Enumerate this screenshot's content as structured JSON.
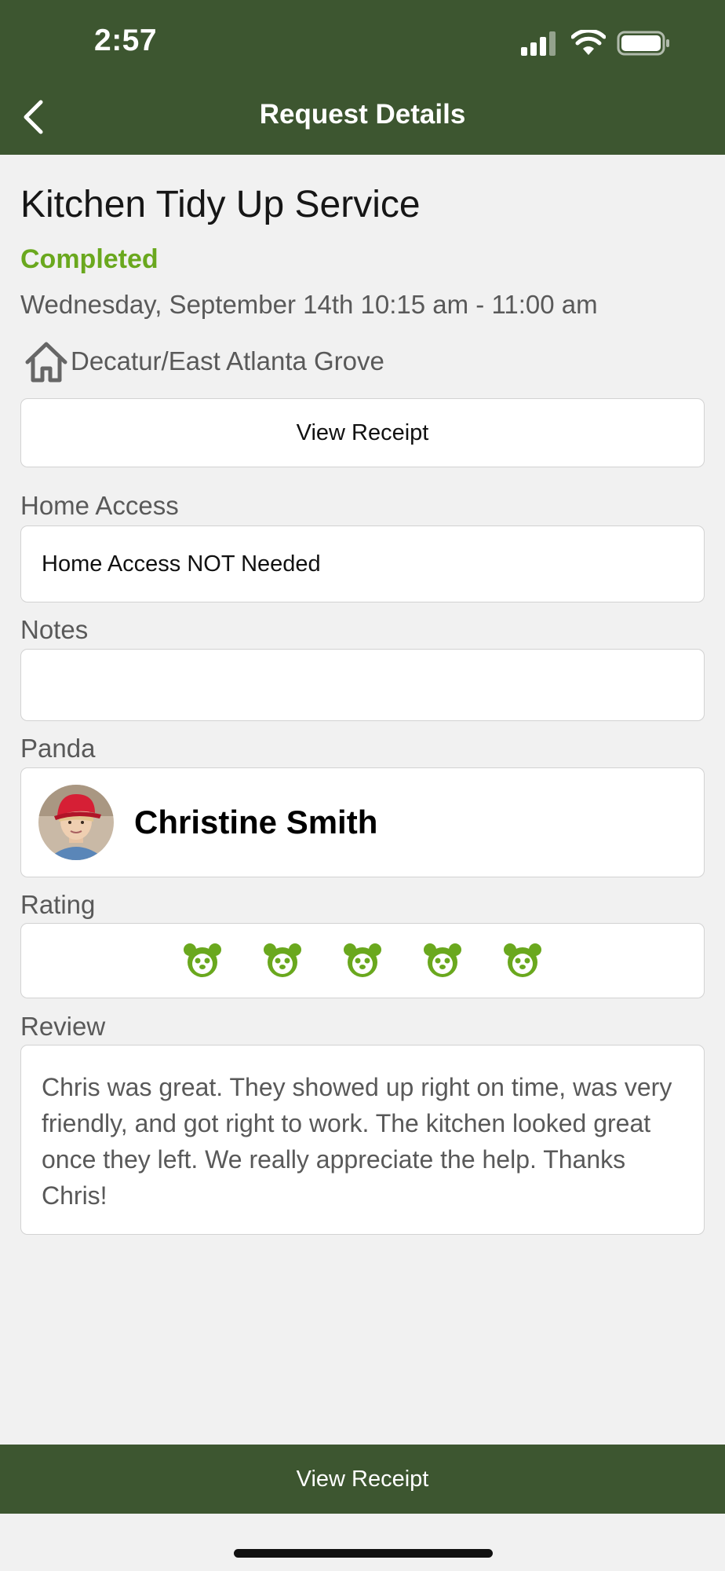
{
  "status_bar": {
    "time": "2:57"
  },
  "header": {
    "title": "Request Details"
  },
  "request": {
    "service": "Kitchen Tidy Up Service",
    "status": "Completed",
    "datetime": "Wednesday, September 14th  10:15 am - 11:00 am",
    "location": "Decatur/East Atlanta Grove",
    "view_receipt_label": "View Receipt"
  },
  "home_access": {
    "label": "Home Access",
    "value": "Home Access NOT Needed"
  },
  "notes": {
    "label": "Notes",
    "value": ""
  },
  "panda": {
    "label": "Panda",
    "name": "Christine Smith"
  },
  "rating": {
    "label": "Rating",
    "value": 5,
    "max": 5
  },
  "review": {
    "label": "Review",
    "text": "Chris was great. They showed up right on time, was very friendly, and got right to work. The kitchen looked great once they left. We really appreciate the help. Thanks Chris!"
  },
  "footer": {
    "button_label": "View Receipt"
  },
  "colors": {
    "header_bg": "#3d5630",
    "accent_green": "#6aa81e",
    "background": "#f1f1f1"
  },
  "icons": {
    "back": "chevron-left-icon",
    "signal": "signal-icon",
    "wifi": "wifi-icon",
    "battery": "battery-icon",
    "home": "home-icon",
    "rating": "panda-face-icon"
  }
}
